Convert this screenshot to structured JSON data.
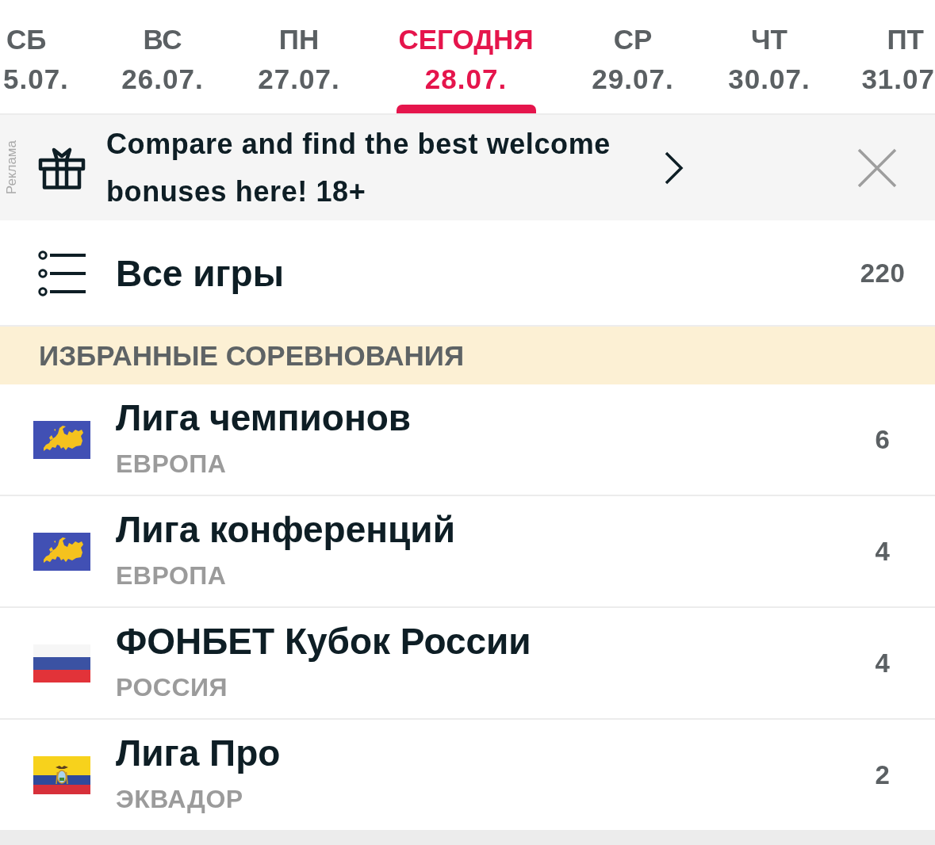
{
  "date_tabs": [
    {
      "day": "СБ",
      "date": "5.07.",
      "selected": false
    },
    {
      "day": "ВС",
      "date": "26.07.",
      "selected": false
    },
    {
      "day": "ПН",
      "date": "27.07.",
      "selected": false
    },
    {
      "day": "СЕГОДНЯ",
      "date": "28.07.",
      "selected": true
    },
    {
      "day": "СР",
      "date": "29.07.",
      "selected": false
    },
    {
      "day": "ЧТ",
      "date": "30.07.",
      "selected": false
    },
    {
      "day": "ПТ",
      "date": "31.07",
      "selected": false
    }
  ],
  "ad_banner": {
    "label": "Реклама",
    "text": "Compare and find the best welcome bonuses here! 18+"
  },
  "all_games": {
    "label": "Все игры",
    "count": "220"
  },
  "favorites": {
    "heading": "ИЗБРАННЫЕ СОРЕВНОВАНИЯ",
    "leagues": [
      {
        "kind": "europe",
        "name": "Лига чемпионов",
        "region": "ЕВРОПА",
        "count": "6"
      },
      {
        "kind": "europe",
        "name": "Лига конференций",
        "region": "ЕВРОПА",
        "count": "4"
      },
      {
        "kind": "russia",
        "name": "ФОНБЕТ Кубок России",
        "region": "РОССИЯ",
        "count": "4"
      },
      {
        "kind": "ecuador",
        "name": "Лига Про",
        "region": "ЭКВАДОР",
        "count": "2"
      }
    ]
  }
}
